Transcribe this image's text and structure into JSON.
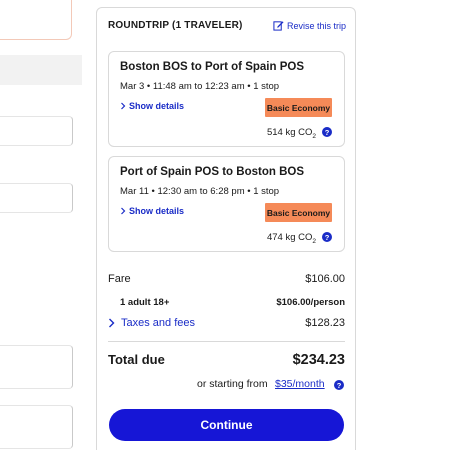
{
  "summary": {
    "trip_title": "ROUNDTRIP (1 TRAVELER)",
    "revise_label": "Revise this trip"
  },
  "flights": [
    {
      "route": "Boston BOS to Port of Spain POS",
      "times": "Mar 3 • 11:48 am to 12:23 am • 1 stop",
      "details_label": "Show details",
      "fare_class": "Basic Economy",
      "co2_value": "514 kg CO",
      "co2_sub": "2"
    },
    {
      "route": "Port of Spain POS to Boston BOS",
      "times": "Mar 11 • 12:30 am to 6:28 pm • 1 stop",
      "details_label": "Show details",
      "fare_class": "Basic Economy",
      "co2_value": "474 kg CO",
      "co2_sub": "2"
    }
  ],
  "pricing": {
    "fare_label": "Fare",
    "fare_value": "$106.00",
    "adult_label": "1 adult 18+",
    "adult_value": "$106.00/person",
    "taxes_label": "Taxes and fees",
    "taxes_value": "$128.23",
    "total_label": "Total due",
    "total_value": "$234.23"
  },
  "financing": {
    "prefix": "or starting from",
    "amount": "$35/month"
  },
  "actions": {
    "continue_label": "Continue"
  },
  "colors": {
    "accent": "#1a2cc7",
    "button": "#1616d6",
    "badge": "#f58a58"
  },
  "icons": {
    "revise": "edit-icon",
    "details": "chevron-right-icon",
    "info": "info-icon"
  }
}
